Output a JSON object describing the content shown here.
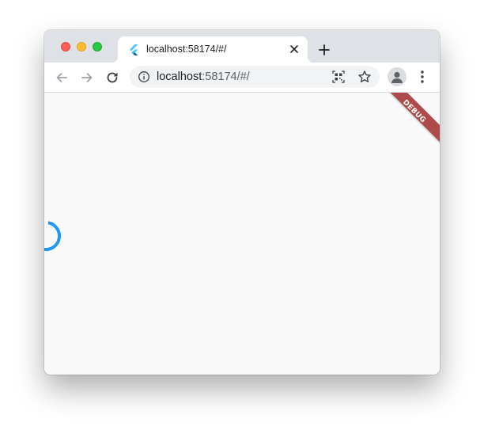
{
  "browser": {
    "tab": {
      "title": "localhost:58174/#/",
      "favicon": "flutter-logo-icon"
    },
    "new_tab_icon": "plus-icon",
    "omnibox": {
      "host": "localhost",
      "rest": ":58174/#/"
    },
    "toolbar_icons": [
      "back-arrow-icon",
      "forward-arrow-icon",
      "reload-icon",
      "info-icon",
      "qr-code-icon",
      "star-icon",
      "profile-icon",
      "more-menu-icon"
    ]
  },
  "app": {
    "debug_banner": "DEBUG",
    "loading": true
  },
  "colors": {
    "tabstrip": "#dee1e6",
    "spinner": "#2196f3",
    "debug_banner": "#a12c2c",
    "content_bg": "#f9f9f9"
  }
}
